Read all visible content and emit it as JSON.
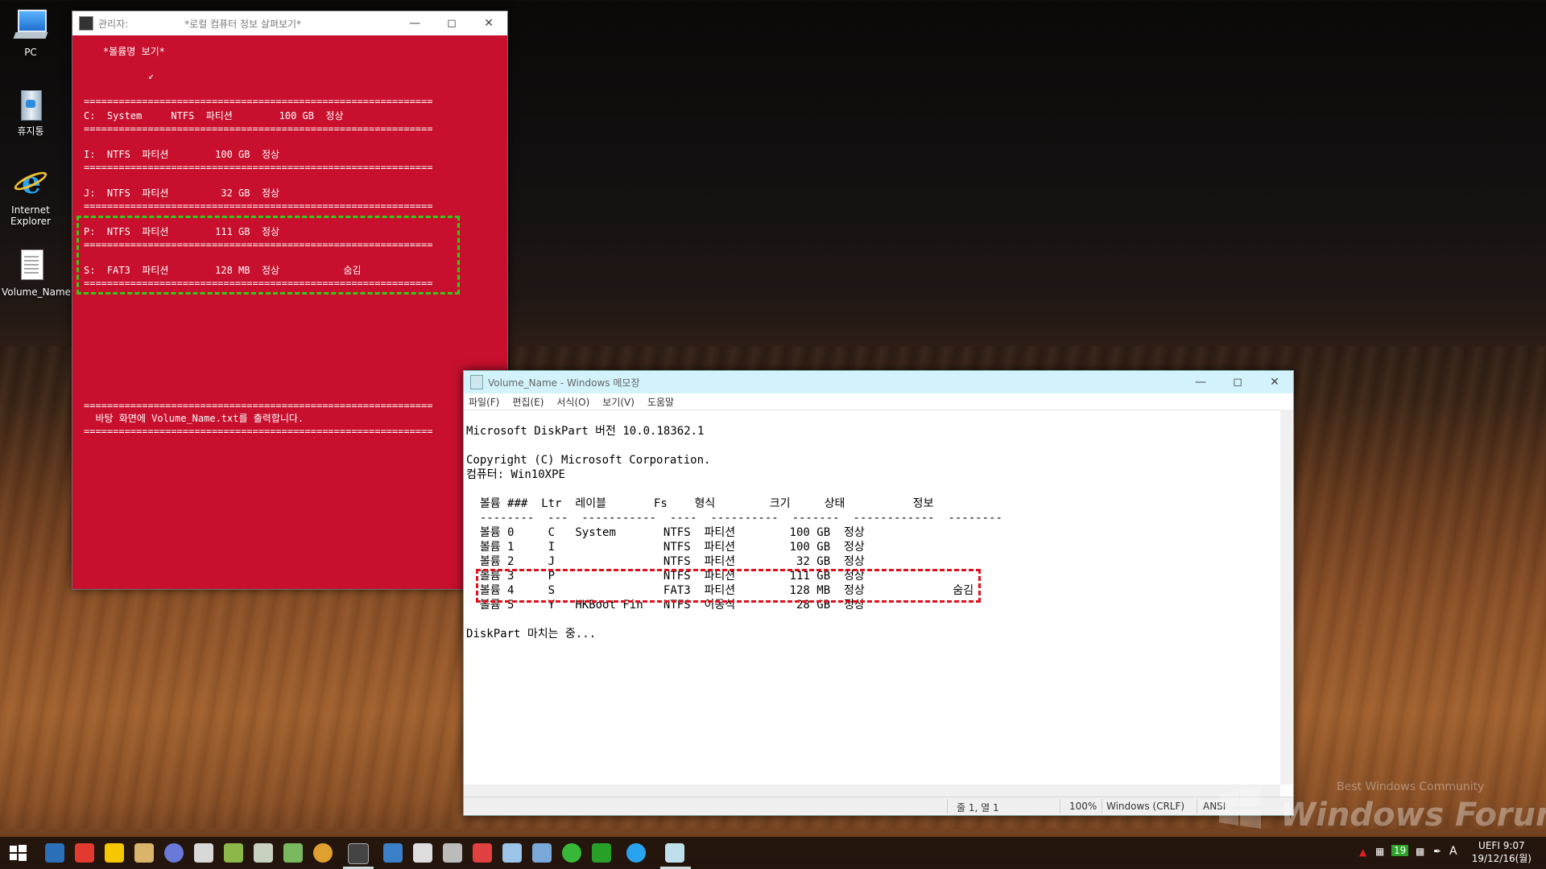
{
  "desktop": {
    "icons": [
      {
        "label": "PC",
        "icon": "computer-icon"
      },
      {
        "label": "휴지통",
        "icon": "recycle-bin-icon"
      },
      {
        "label": "Internet Explorer",
        "icon": "internet-explorer-icon"
      },
      {
        "label": "Volume_Name",
        "icon": "text-file-icon"
      }
    ]
  },
  "console": {
    "title_admin": "관리자:",
    "title": "*로컬 컴퓨터 정보 살펴보기*",
    "heading": "*볼륨명 보기*",
    "cursor": "↙",
    "separator": "============================================================",
    "lines": [
      "C:  System     NTFS  파티션        100 GB  정상",
      "I:  NTFS  파티션        100 GB  정상",
      "J:  NTFS  파티션         32 GB  정상",
      "P:  NTFS  파티션        111 GB  정상",
      "S:  FAT3  파티션        128 MB  정상           숨김"
    ],
    "output_message": "  바탕 화면에 Volume_Name.txt를 출력합니다."
  },
  "notepad": {
    "title": "Volume_Name - Windows 메모장",
    "menu": [
      "파일(F)",
      "편집(E)",
      "서식(O)",
      "보기(V)",
      "도움말"
    ],
    "lines": [
      "Microsoft DiskPart 버전 10.0.18362.1",
      "",
      "Copyright (C) Microsoft Corporation.",
      "컴퓨터: Win10XPE",
      "",
      "  볼륨 ###  Ltr  레이블       Fs    형식        크기     상태          정보",
      "  --------  ---  -----------  ----  ----------  -------  ------------  --------",
      "  볼륨 0     C   System       NTFS  파티션        100 GB  정상",
      "  볼륨 1     I                NTFS  파티션        100 GB  정상",
      "  볼륨 2     J                NTFS  파티션         32 GB  정상",
      "  볼륨 3     P                NTFS  파티션        111 GB  정상",
      "  볼륨 4     S                FAT3  파티션        128 MB  정상             숨김",
      "  볼륨 5     Y   HKBoot Fin   NTFS  이동식         28 GB  정상",
      "",
      "DiskPart 마치는 중..."
    ],
    "status": {
      "position": "줄 1, 열 1",
      "zoom": "100%",
      "line_ending": "Windows (CRLF)",
      "encoding": "ANSI"
    }
  },
  "watermark": {
    "small": "Best Windows Community",
    "big": "Windows Forum"
  },
  "taskbar": {
    "apps": [
      "start-icon",
      "system-info-icon",
      "anydesk-icon",
      "potplayer-icon",
      "explorer-icon",
      "browser-icon",
      "registry-icon",
      "drive-icon",
      "usb-icon",
      "disk-icon",
      "chrome-icon",
      "console-icon",
      "network-icon",
      "security-icon",
      "tools-icon",
      "tiles-icon",
      "file-icon",
      "copy-icon",
      "refresh-icon",
      "hex-editor-icon",
      "internet-explorer-icon",
      "notepad-icon"
    ],
    "tray": {
      "badge": "19",
      "ime": "A",
      "uefi": "UEFI",
      "time": "9:07",
      "date": "19/12/16(월)"
    }
  }
}
